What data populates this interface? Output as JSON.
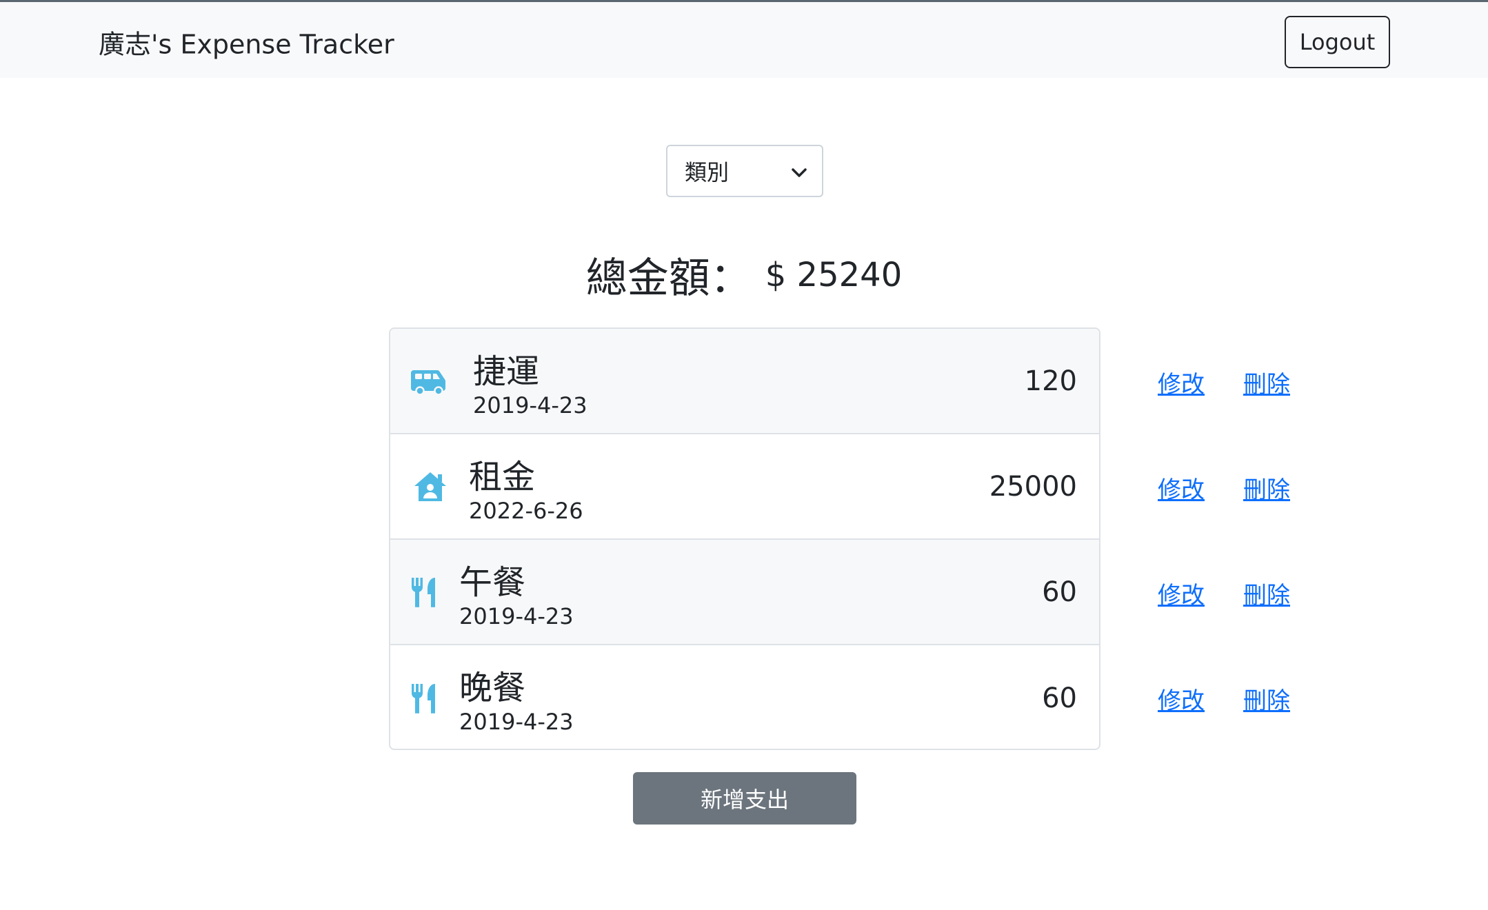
{
  "navbar": {
    "brand": "廣志's Expense Tracker",
    "logout_label": "Logout"
  },
  "filter": {
    "selected": "類別",
    "icon": "chevron-down-icon"
  },
  "total": {
    "label": "總金額：",
    "value": "$ 25240"
  },
  "records": [
    {
      "name": "捷運",
      "date": "2019-4-23",
      "amount": "120",
      "icon": "van-icon"
    },
    {
      "name": "租金",
      "date": "2022-6-26",
      "amount": "25000",
      "icon": "house-user-icon"
    },
    {
      "name": "午餐",
      "date": "2019-4-23",
      "amount": "60",
      "icon": "utensils-icon"
    },
    {
      "name": "晚餐",
      "date": "2019-4-23",
      "amount": "60",
      "icon": "utensils-icon"
    }
  ],
  "actions": {
    "edit_label": "修改",
    "delete_label": "刪除"
  },
  "add_button_label": "新增支出",
  "colors": {
    "icon": "#4fb9e3",
    "link": "#0d6efd",
    "navbar_bg": "#f8f9fa",
    "add_button_bg": "#6c757d"
  }
}
